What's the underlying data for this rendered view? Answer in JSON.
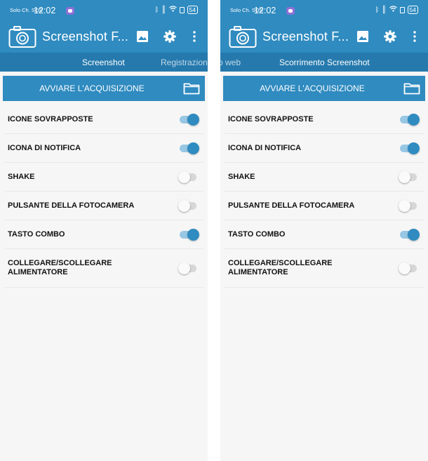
{
  "status_bar": {
    "carrier": "Solo Ch. SOS",
    "time": "12:02",
    "battery": "54"
  },
  "app_bar": {
    "title": "Screenshot F..."
  },
  "left_screen": {
    "tabs": [
      {
        "label": "Screenshot",
        "selected": true
      },
      {
        "label": "Registrazione web",
        "selected": false
      }
    ]
  },
  "right_screen": {
    "tabs": [
      {
        "label": "o web",
        "selected": false
      },
      {
        "label": "Scorrimento Screenshot",
        "selected": true
      }
    ]
  },
  "action": {
    "capture_label": "AVVIARE L'ACQUISIZIONE",
    "icon": "folder-icon"
  },
  "settings": [
    {
      "label": "ICONE SOVRAPPOSTE",
      "enabled": true
    },
    {
      "label": "ICONA DI NOTIFICA",
      "enabled": true
    },
    {
      "label": "SHAKE",
      "enabled": false
    },
    {
      "label": "PULSANTE DELLA FOTOCAMERA",
      "enabled": false
    },
    {
      "label": "TASTO COMBO",
      "enabled": true
    },
    {
      "label": "COLLEGARE/SCOLLEGARE ALIMENTATORE",
      "enabled": false
    }
  ],
  "colors": {
    "primary": "#2f8bc0",
    "tab_bar": "#2579ad",
    "toggle_on": "#2f8bc0",
    "toggle_off": "#d7d7d7"
  }
}
